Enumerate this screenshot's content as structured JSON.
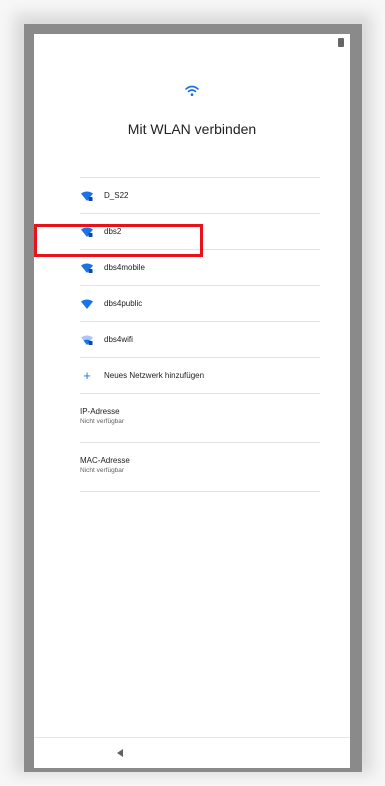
{
  "header": {
    "icon": "wifi-icon",
    "title": "Mit WLAN verbinden"
  },
  "networks": [
    {
      "label": "D_S22",
      "icon": "wifi-locked-icon"
    },
    {
      "label": "dbs2",
      "icon": "wifi-locked-icon"
    },
    {
      "label": "dbs4mobile",
      "icon": "wifi-locked-icon"
    },
    {
      "label": "dbs4public",
      "icon": "wifi-open-icon"
    },
    {
      "label": "dbs4wifi",
      "icon": "wifi-locked-weak-icon"
    }
  ],
  "add_network": {
    "label": "Neues Netzwerk hinzufügen",
    "icon": "plus-icon"
  },
  "ip": {
    "title": "IP-Adresse",
    "value": "Nicht verfügbar"
  },
  "mac": {
    "title": "MAC-Adresse",
    "value": "Nicht verfügbar"
  },
  "nav": {
    "icon": "back-triangle-icon"
  },
  "colors": {
    "accent": "#1a73e8",
    "highlight": "#e8121b"
  }
}
